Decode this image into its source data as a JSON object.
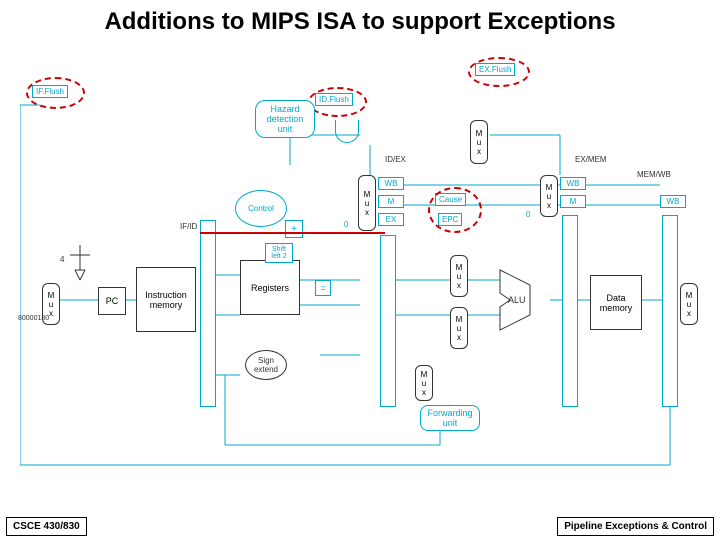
{
  "title": "Additions to MIPS ISA to support Exceptions",
  "footer": {
    "left": "CSCE 430/830",
    "right": "Pipeline Exceptions & Control"
  },
  "blocks": {
    "if_flush": "IF.Flush",
    "ex_flush": "EX.Flush",
    "id_flush": "ID.Flush",
    "hazard": "Hazard\ndetection\nunit",
    "control": "Control",
    "pc": "PC",
    "imem": "Instruction\nmemory",
    "registers": "Registers",
    "sign_ext": "Sign\nextend",
    "shift": "Shift\nleft 2",
    "alu": "ALU",
    "dmem": "Data\nmemory",
    "fwd": "Forwarding\nunit",
    "cause": "Cause",
    "epc": "EPC",
    "addr_const": "80000180",
    "plus4": "4",
    "eq": "=",
    "zero": "0",
    "mux": "M\nu\nx"
  },
  "stages": {
    "if_id": "IF/ID",
    "id_ex": "ID/EX",
    "ex_mem": "EX/MEM",
    "mem_wb": "MEM/WB"
  },
  "signals": {
    "wb1": "WB",
    "m1": "M",
    "ex": "EX",
    "wb2": "WB",
    "m2": "M",
    "wb3": "WB"
  }
}
